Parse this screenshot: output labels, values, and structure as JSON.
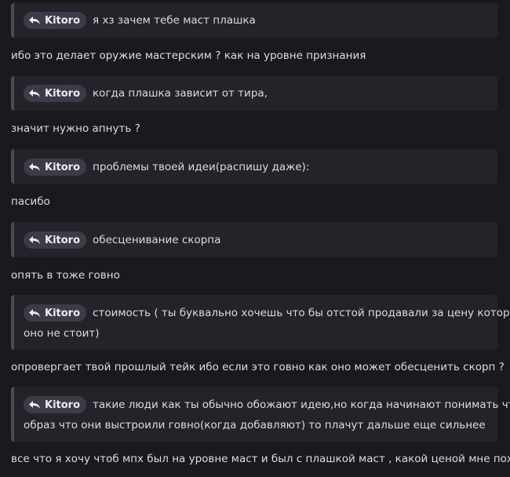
{
  "author_chip": "Kitoro",
  "quotes": [
    {
      "line1": "я хз зачем тебе маст плашка"
    },
    {
      "line1": "когда плашка зависит от тира,"
    },
    {
      "line1": "проблемы твоей идеи(распишу даже):"
    },
    {
      "line1": "обесценивание скорпа"
    },
    {
      "line1": "стоимость ( ты буквально хочешь что бы отстой продавали за цену которого",
      "line2": "оно не стоит)"
    },
    {
      "line1": "такие люди как ты обычно обожают идею,но когда начинают понимать что",
      "line2": "образ что они выстроили говно(когда добавляют) то плачут дальше еще сильнее"
    }
  ],
  "replies": [
    "ибо это делает оружие мастерским ? как на уровне признания",
    "значит нужно апнуть ?",
    "пасибо",
    "опять в тоже говно",
    "опровергает твой прошлый тейк ибо если это говно как оно может обесценить скорп ?",
    "все что я хочу чтоб мпх был на уровне маст и был с плашкой маст , какой ценой мне похуй"
  ]
}
